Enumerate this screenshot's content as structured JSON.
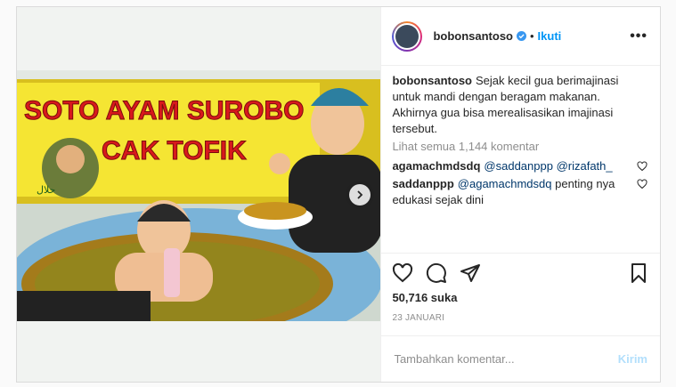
{
  "post": {
    "author": "bobonsantoso",
    "separator": "•",
    "follow_label": "Ikuti",
    "more_label": "•••",
    "caption_user": "bobonsantoso",
    "caption_text": "Sejak kecil gua berimajinasi untuk mandi dengan beragam makanan. Akhirnya gua bisa merealisasikan imajinasi tersebut.",
    "view_all": "Lihat semua 1,144 komentar",
    "comments": [
      {
        "user": "agamachmdsdq",
        "mention": "@saddanppp @rizafath_",
        "text": ""
      },
      {
        "user": "saddanppp",
        "mention": "@agamachmdsdq",
        "text": "penting nya edukasi sejak dini"
      }
    ],
    "likes": "50,716 suka",
    "date": "23 JANUARI",
    "comment_placeholder": "Tambahkan komentar...",
    "send_label": "Kirim"
  },
  "photo": {
    "banner_line1": "SOTO AYAM SUROBO",
    "banner_line2": "CAK TOFIK",
    "halal": "حلال"
  },
  "colors": {
    "accent": "#0095f6",
    "verified": "#3897f0",
    "banner_yellow": "#f5e533",
    "banner_red": "#d7191c"
  },
  "icons": [
    "verified-icon",
    "heart-icon",
    "comment-icon",
    "share-icon",
    "save-icon",
    "chevron-right-icon"
  ]
}
